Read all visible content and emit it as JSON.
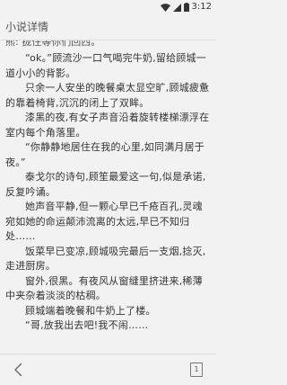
{
  "status_bar": {
    "time": "3:12",
    "icons": [
      "wifi-icon",
      "signal-icon",
      "battery-icon"
    ]
  },
  "header": {
    "title": "小说详情"
  },
  "content": {
    "partial_top_line": "熊: 拢住等你们回西。",
    "paragraphs": [
      "“ok。”顾流沙一口气喝完牛奶,留给顾城一道小小的背影。",
      "只余一人安坐的晚餐桌太显空旷,顾城疲惫的靠着椅背,沉沉的闭上了双眸。",
      "漆黑的夜,有女子声音沿着旋转楼梯漂浮在室内每个角落里。",
      "“你静静地居住在我的心里,如同满月居于夜。”",
      "泰戈尔的诗句,顾笙最爱这一句,似是承诺,反复吟诵。",
      "她声音平静,但一颗心早已千疮百孔,灵魂宛如她的命运颠沛流离的太远,早已不知归处……",
      "饭菜早已变凉,顾城吸完最后一支烟,捻灭,走进厨房。",
      "窗外,很黑。有夜风从窗缝里挤进来,稀薄中夹杂着淡淡的枯稠。",
      "顾城端着晚餐和牛奶上了楼。",
      "“哥,放我出去吧!我不闹……"
    ]
  },
  "bottom_bar": {
    "back_label": "<",
    "page_label": "1"
  }
}
